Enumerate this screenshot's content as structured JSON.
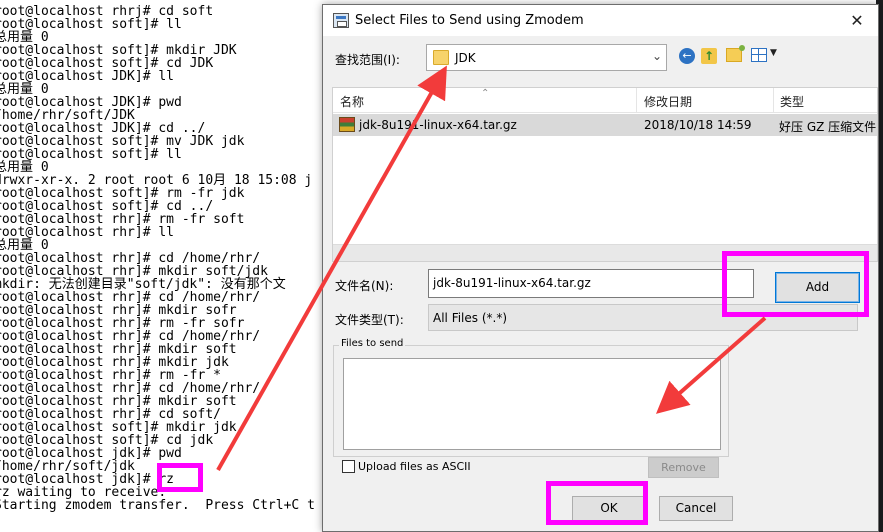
{
  "terminal": {
    "lines": [
      "root@localhost rhrj# cd soft",
      "root@localhost soft]# ll",
      "总用量 0",
      "root@localhost soft]# mkdir JDK",
      "root@localhost soft]# cd JDK",
      "root@localhost JDK]# ll",
      "总用量 0",
      "root@localhost JDK]# pwd",
      "/home/rhr/soft/JDK",
      "root@localhost JDK]# cd ../",
      "root@localhost soft]# mv JDK jdk",
      "root@localhost soft]# ll",
      "总用量 0",
      "drwxr-xr-x. 2 root root 6 10月 18 15:08 j",
      "root@localhost soft]# rm -fr jdk",
      "root@localhost soft]# cd ../",
      "root@localhost rhr]# rm -fr soft",
      "root@localhost rhr]# ll",
      "总用量 0",
      "root@localhost rhr]# cd /home/rhr/",
      "root@localhost rhr]# mkdir soft/jdk",
      "mkdir: 无法创建目录\"soft/jdk\": 没有那个文",
      "root@localhost rhr]# cd /home/rhr/",
      "root@localhost rhr]# mkdir sofr",
      "root@localhost rhr]# rm -fr sofr",
      "root@localhost rhr]# cd /home/rhr/",
      "root@localhost rhr]# mkdir soft",
      "root@localhost rhr]# mkdir jdk",
      "root@localhost rhr]# rm -fr *",
      "root@localhost rhr]# cd /home/rhr/",
      "root@localhost rhr]# mkdir soft",
      "root@localhost rhr]# cd soft/",
      "root@localhost soft]# mkdir jdk",
      "root@localhost soft]# cd jdk",
      "root@localhost jdk]# pwd",
      "/home/rhr/soft/jdk",
      "root@localhost jdk]# rz",
      "rz waiting to receive.",
      "Starting zmodem transfer.  Press Ctrl+C t"
    ]
  },
  "dialog": {
    "title": "Select Files to Send using Zmodem",
    "close_glyph": "✕",
    "look_in_label": "查找范围(I):",
    "look_in_value": "JDK",
    "columns": {
      "name": "名称",
      "date": "修改日期",
      "type": "类型"
    },
    "files": [
      {
        "name": "jdk-8u191-linux-x64.tar.gz",
        "date": "2018/10/18 14:59",
        "type": "好压 GZ 压缩文件"
      }
    ],
    "filename_label": "文件名(N):",
    "filename_value": "jdk-8u191-linux-x64.tar.gz",
    "filetype_label": "文件类型(T):",
    "filetype_value": "All Files (*.*)",
    "add_label": "Add",
    "files_to_send_label": "Files to send",
    "ascii_label": "Upload files as ASCII",
    "remove_label": "Remove",
    "ok_label": "OK",
    "cancel_label": "Cancel"
  },
  "icons": [
    "window-icon",
    "close-icon",
    "folder-icon",
    "chevron-down-icon",
    "back-icon",
    "up-folder-icon",
    "new-folder-icon",
    "view-menu-icon",
    "archive-file-icon"
  ],
  "colors": {
    "highlight": "#ff00ff",
    "arrow": "#f23b3b",
    "add_button_border": "#0078d7",
    "selected_row": "#d9d9d9"
  }
}
